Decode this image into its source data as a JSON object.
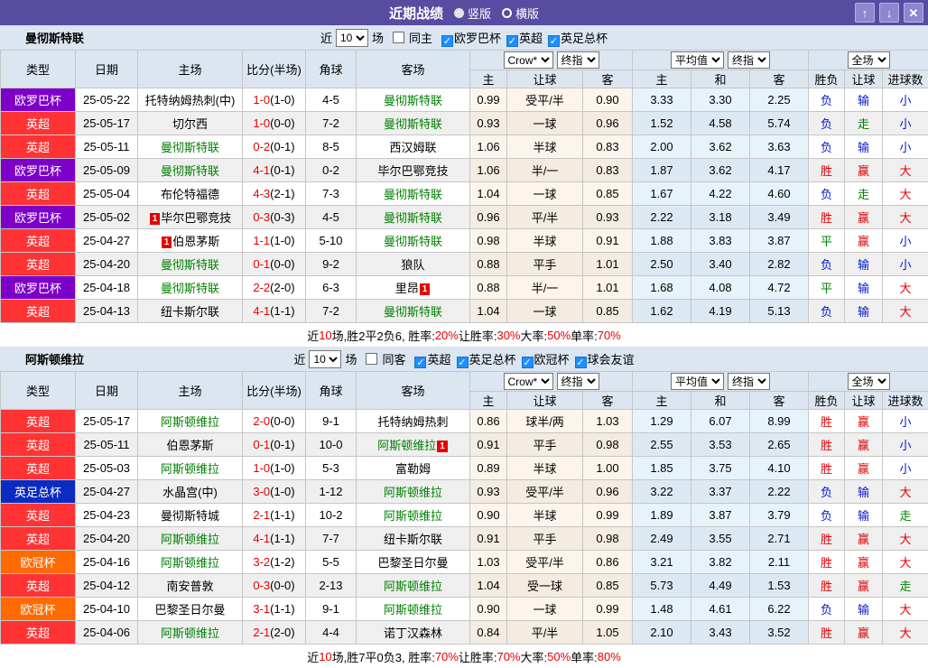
{
  "title_bar": {
    "title": "近期战绩",
    "radio_vertical": "竖版",
    "radio_horizontal": "横版",
    "up_button": "↑",
    "down_button": "↓",
    "close_button": "✕"
  },
  "labels": {
    "near": "近",
    "games": "场"
  },
  "table_header": {
    "type": "类型",
    "date": "日期",
    "home": "主场",
    "score": "比分(半场)",
    "corner": "角球",
    "away": "客场",
    "odds_company": "Crow*",
    "odds_stage": "终指",
    "avg_company": "平均值",
    "avg_stage": "终指",
    "result_scope": "全场",
    "sub_home": "主",
    "sub_handicap": "让球",
    "sub_away": "客",
    "sub_avg_home": "主",
    "sub_avg_draw": "和",
    "sub_avg_away": "客",
    "sub_winlose": "胜负",
    "sub_hcap_result": "让球",
    "sub_goals": "进球数"
  },
  "type_colors": {
    "欧罗巴杯": "#7d00c8",
    "英超": "#ff3334",
    "英足总杯": "#0b2bc2",
    "欧冠杯": "#ff6a00"
  },
  "result_colors": {
    "胜": "t-red",
    "赢": "t-red",
    "大": "t-red",
    "负": "t-blue",
    "输": "t-blue",
    "小": "t-blue",
    "平": "t-green",
    "走": "t-green"
  },
  "sections": [
    {
      "team": "曼彻斯特联",
      "filter": {
        "games": "10",
        "same_label": "同主",
        "same_checked": false,
        "leagues": [
          {
            "label": "欧罗巴杯",
            "checked": true
          },
          {
            "label": "英超",
            "checked": true
          },
          {
            "label": "英足总杯",
            "checked": true
          }
        ]
      },
      "rows": [
        {
          "type": "欧罗巴杯",
          "date": "25-05-22",
          "home": {
            "name": "托特纳姆热刺(中)"
          },
          "score": "1-0",
          "half": "(1-0)",
          "corner": "4-5",
          "away": {
            "name": "曼彻斯特联",
            "focal": true
          },
          "odds": [
            "0.99",
            "受平/半",
            "0.90"
          ],
          "avg": [
            "3.33",
            "3.30",
            "2.25"
          ],
          "res": [
            "负",
            "输",
            "小"
          ]
        },
        {
          "type": "英超",
          "date": "25-05-17",
          "home": {
            "name": "切尔西"
          },
          "score": "1-0",
          "half": "(0-0)",
          "corner": "7-2",
          "away": {
            "name": "曼彻斯特联",
            "focal": true
          },
          "odds": [
            "0.93",
            "一球",
            "0.96"
          ],
          "avg": [
            "1.52",
            "4.58",
            "5.74"
          ],
          "res": [
            "负",
            "走",
            "小"
          ]
        },
        {
          "type": "英超",
          "date": "25-05-11",
          "home": {
            "name": "曼彻斯特联",
            "focal": true
          },
          "score": "0-2",
          "half": "(0-1)",
          "corner": "8-5",
          "away": {
            "name": "西汉姆联"
          },
          "odds": [
            "1.06",
            "半球",
            "0.83"
          ],
          "avg": [
            "2.00",
            "3.62",
            "3.63"
          ],
          "res": [
            "负",
            "输",
            "小"
          ]
        },
        {
          "type": "欧罗巴杯",
          "date": "25-05-09",
          "home": {
            "name": "曼彻斯特联",
            "focal": true
          },
          "score": "4-1",
          "half": "(0-1)",
          "corner": "0-2",
          "away": {
            "name": "毕尔巴鄂竞技"
          },
          "odds": [
            "1.06",
            "半/一",
            "0.83"
          ],
          "avg": [
            "1.87",
            "3.62",
            "4.17"
          ],
          "res": [
            "胜",
            "赢",
            "大"
          ]
        },
        {
          "type": "英超",
          "date": "25-05-04",
          "home": {
            "name": "布伦特福德"
          },
          "score": "4-3",
          "half": "(2-1)",
          "corner": "7-3",
          "away": {
            "name": "曼彻斯特联",
            "focal": true
          },
          "odds": [
            "1.04",
            "一球",
            "0.85"
          ],
          "avg": [
            "1.67",
            "4.22",
            "4.60"
          ],
          "res": [
            "负",
            "走",
            "大"
          ]
        },
        {
          "type": "欧罗巴杯",
          "date": "25-05-02",
          "home": {
            "name": "毕尔巴鄂竞技",
            "rc": "before"
          },
          "score": "0-3",
          "half": "(0-3)",
          "corner": "4-5",
          "away": {
            "name": "曼彻斯特联",
            "focal": true
          },
          "odds": [
            "0.96",
            "平/半",
            "0.93"
          ],
          "avg": [
            "2.22",
            "3.18",
            "3.49"
          ],
          "res": [
            "胜",
            "赢",
            "大"
          ]
        },
        {
          "type": "英超",
          "date": "25-04-27",
          "home": {
            "name": "伯恩茅斯",
            "rc": "before"
          },
          "score": "1-1",
          "half": "(1-0)",
          "corner": "5-10",
          "away": {
            "name": "曼彻斯特联",
            "focal": true
          },
          "odds": [
            "0.98",
            "半球",
            "0.91"
          ],
          "avg": [
            "1.88",
            "3.83",
            "3.87"
          ],
          "res": [
            "平",
            "赢",
            "小"
          ]
        },
        {
          "type": "英超",
          "date": "25-04-20",
          "home": {
            "name": "曼彻斯特联",
            "focal": true
          },
          "score": "0-1",
          "half": "(0-0)",
          "corner": "9-2",
          "away": {
            "name": "狼队"
          },
          "odds": [
            "0.88",
            "平手",
            "1.01"
          ],
          "avg": [
            "2.50",
            "3.40",
            "2.82"
          ],
          "res": [
            "负",
            "输",
            "小"
          ]
        },
        {
          "type": "欧罗巴杯",
          "date": "25-04-18",
          "home": {
            "name": "曼彻斯特联",
            "focal": true
          },
          "score": "2-2",
          "half": "(2-0)",
          "corner": "6-3",
          "away": {
            "name": "里昂",
            "rc": "after"
          },
          "odds": [
            "0.88",
            "半/一",
            "1.01"
          ],
          "avg": [
            "1.68",
            "4.08",
            "4.72"
          ],
          "res": [
            "平",
            "输",
            "大"
          ]
        },
        {
          "type": "英超",
          "date": "25-04-13",
          "home": {
            "name": "纽卡斯尔联"
          },
          "score": "4-1",
          "half": "(1-1)",
          "corner": "7-2",
          "away": {
            "name": "曼彻斯特联",
            "focal": true
          },
          "odds": [
            "1.04",
            "一球",
            "0.85"
          ],
          "avg": [
            "1.62",
            "4.19",
            "5.13"
          ],
          "res": [
            "负",
            "输",
            "大"
          ]
        }
      ],
      "summary": [
        {
          "t": "近",
          "red": false
        },
        {
          "t": "10",
          "red": true
        },
        {
          "t": "场,胜2平2负6, 胜率:",
          "red": false
        },
        {
          "t": "20%",
          "red": true
        },
        {
          "t": " 让胜率:",
          "red": false
        },
        {
          "t": "30%",
          "red": true
        },
        {
          "t": " 大率:",
          "red": false
        },
        {
          "t": "50%",
          "red": true
        },
        {
          "t": " 单率:",
          "red": false
        },
        {
          "t": "70%",
          "red": true
        }
      ]
    },
    {
      "team": "阿斯顿维拉",
      "filter": {
        "games": "10",
        "same_label": "同客",
        "same_checked": false,
        "leagues": [
          {
            "label": "英超",
            "checked": true
          },
          {
            "label": "英足总杯",
            "checked": true
          },
          {
            "label": "欧冠杯",
            "checked": true
          },
          {
            "label": "球会友谊",
            "checked": true
          }
        ]
      },
      "rows": [
        {
          "type": "英超",
          "date": "25-05-17",
          "home": {
            "name": "阿斯顿维拉",
            "focal": true
          },
          "score": "2-0",
          "half": "(0-0)",
          "corner": "9-1",
          "away": {
            "name": "托特纳姆热刺"
          },
          "odds": [
            "0.86",
            "球半/两",
            "1.03"
          ],
          "avg": [
            "1.29",
            "6.07",
            "8.99"
          ],
          "res": [
            "胜",
            "赢",
            "小"
          ]
        },
        {
          "type": "英超",
          "date": "25-05-11",
          "home": {
            "name": "伯恩茅斯"
          },
          "score": "0-1",
          "half": "(0-1)",
          "corner": "10-0",
          "away": {
            "name": "阿斯顿维拉",
            "focal": true,
            "rc": "after"
          },
          "odds": [
            "0.91",
            "平手",
            "0.98"
          ],
          "avg": [
            "2.55",
            "3.53",
            "2.65"
          ],
          "res": [
            "胜",
            "赢",
            "小"
          ]
        },
        {
          "type": "英超",
          "date": "25-05-03",
          "home": {
            "name": "阿斯顿维拉",
            "focal": true
          },
          "score": "1-0",
          "half": "(1-0)",
          "corner": "5-3",
          "away": {
            "name": "富勒姆"
          },
          "odds": [
            "0.89",
            "半球",
            "1.00"
          ],
          "avg": [
            "1.85",
            "3.75",
            "4.10"
          ],
          "res": [
            "胜",
            "赢",
            "小"
          ]
        },
        {
          "type": "英足总杯",
          "date": "25-04-27",
          "home": {
            "name": "水晶宫(中)"
          },
          "score": "3-0",
          "half": "(1-0)",
          "corner": "1-12",
          "away": {
            "name": "阿斯顿维拉",
            "focal": true
          },
          "odds": [
            "0.93",
            "受平/半",
            "0.96"
          ],
          "avg": [
            "3.22",
            "3.37",
            "2.22"
          ],
          "res": [
            "负",
            "输",
            "大"
          ]
        },
        {
          "type": "英超",
          "date": "25-04-23",
          "home": {
            "name": "曼彻斯特城"
          },
          "score": "2-1",
          "half": "(1-1)",
          "corner": "10-2",
          "away": {
            "name": "阿斯顿维拉",
            "focal": true
          },
          "odds": [
            "0.90",
            "半球",
            "0.99"
          ],
          "avg": [
            "1.89",
            "3.87",
            "3.79"
          ],
          "res": [
            "负",
            "输",
            "走"
          ]
        },
        {
          "type": "英超",
          "date": "25-04-20",
          "home": {
            "name": "阿斯顿维拉",
            "focal": true
          },
          "score": "4-1",
          "half": "(1-1)",
          "corner": "7-7",
          "away": {
            "name": "纽卡斯尔联"
          },
          "odds": [
            "0.91",
            "平手",
            "0.98"
          ],
          "avg": [
            "2.49",
            "3.55",
            "2.71"
          ],
          "res": [
            "胜",
            "赢",
            "大"
          ]
        },
        {
          "type": "欧冠杯",
          "date": "25-04-16",
          "home": {
            "name": "阿斯顿维拉",
            "focal": true
          },
          "score": "3-2",
          "half": "(1-2)",
          "corner": "5-5",
          "away": {
            "name": "巴黎圣日尔曼"
          },
          "odds": [
            "1.03",
            "受平/半",
            "0.86"
          ],
          "avg": [
            "3.21",
            "3.82",
            "2.11"
          ],
          "res": [
            "胜",
            "赢",
            "大"
          ]
        },
        {
          "type": "英超",
          "date": "25-04-12",
          "home": {
            "name": "南安普敦"
          },
          "score": "0-3",
          "half": "(0-0)",
          "corner": "2-13",
          "away": {
            "name": "阿斯顿维拉",
            "focal": true
          },
          "odds": [
            "1.04",
            "受一球",
            "0.85"
          ],
          "avg": [
            "5.73",
            "4.49",
            "1.53"
          ],
          "res": [
            "胜",
            "赢",
            "走"
          ]
        },
        {
          "type": "欧冠杯",
          "date": "25-04-10",
          "home": {
            "name": "巴黎圣日尔曼"
          },
          "score": "3-1",
          "half": "(1-1)",
          "corner": "9-1",
          "away": {
            "name": "阿斯顿维拉",
            "focal": true
          },
          "odds": [
            "0.90",
            "一球",
            "0.99"
          ],
          "avg": [
            "1.48",
            "4.61",
            "6.22"
          ],
          "res": [
            "负",
            "输",
            "大"
          ]
        },
        {
          "type": "英超",
          "date": "25-04-06",
          "home": {
            "name": "阿斯顿维拉",
            "focal": true
          },
          "score": "2-1",
          "half": "(2-0)",
          "corner": "4-4",
          "away": {
            "name": "诺丁汉森林"
          },
          "odds": [
            "0.84",
            "平/半",
            "1.05"
          ],
          "avg": [
            "2.10",
            "3.43",
            "3.52"
          ],
          "res": [
            "胜",
            "赢",
            "大"
          ]
        }
      ],
      "summary": [
        {
          "t": "近",
          "red": false
        },
        {
          "t": "10",
          "red": true
        },
        {
          "t": "场,胜7平0负3, 胜率:",
          "red": false
        },
        {
          "t": "70%",
          "red": true
        },
        {
          "t": " 让胜率:",
          "red": false
        },
        {
          "t": "70%",
          "red": true
        },
        {
          "t": " 大率:",
          "red": false
        },
        {
          "t": "50%",
          "red": true
        },
        {
          "t": " 单率:",
          "red": false
        },
        {
          "t": "80%",
          "red": true
        }
      ]
    }
  ]
}
